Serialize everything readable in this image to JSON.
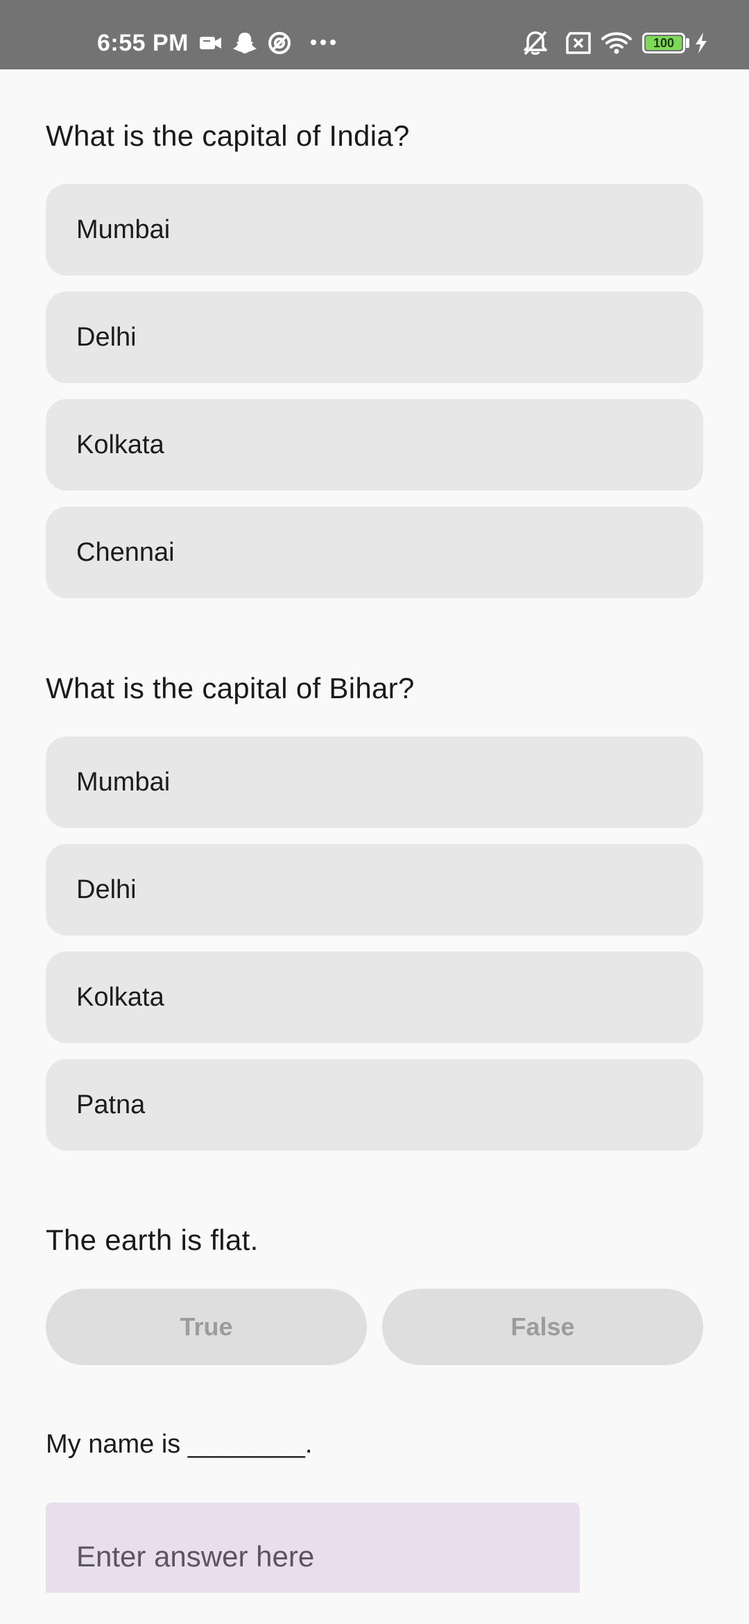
{
  "status_bar": {
    "time": "6:55 PM",
    "battery_level": "100",
    "icons": [
      "video-call-icon",
      "snapchat-icon",
      "vpn-icon",
      "more-dots-icon",
      "bell-off-icon",
      "no-sim-icon",
      "wifi-icon",
      "battery-icon",
      "charging-icon"
    ],
    "battery_color": "#7ed957"
  },
  "quiz": {
    "q1": {
      "question": "What is the capital of India?",
      "options": [
        "Mumbai",
        "Delhi",
        "Kolkata",
        "Chennai"
      ]
    },
    "q2": {
      "question": "What is the capital of Bihar?",
      "options": [
        "Mumbai",
        "Delhi",
        "Kolkata",
        "Patna"
      ]
    },
    "q3": {
      "statement": "The earth is flat.",
      "true_label": "True",
      "false_label": "False"
    },
    "q4": {
      "prompt": "My name is ________.",
      "placeholder": "Enter answer here"
    }
  },
  "colors": {
    "status_bar_bg": "#737373",
    "option_bg": "#e7e7e7",
    "tf_button_bg": "#dedede",
    "input_bg": "#e8dfec",
    "page_bg": "#f9f9f9"
  }
}
